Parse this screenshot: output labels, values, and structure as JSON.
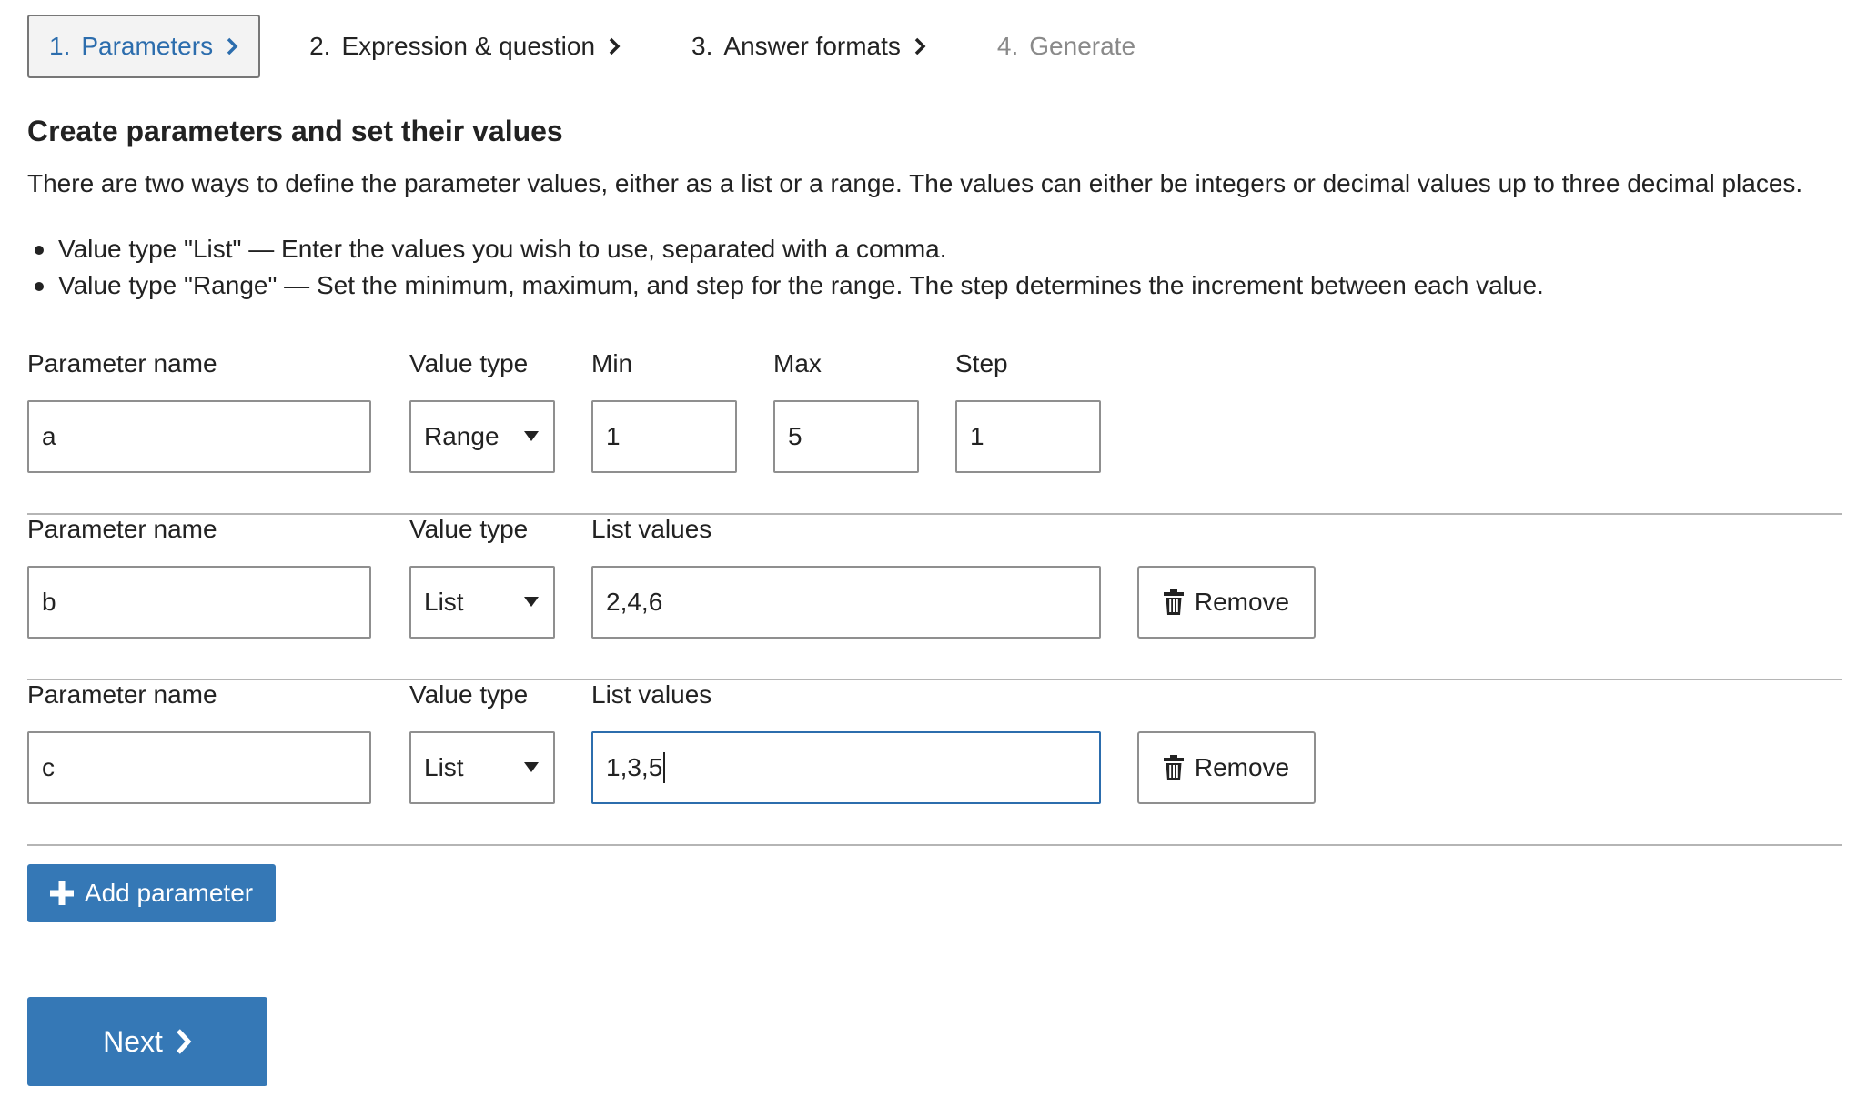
{
  "steps": [
    {
      "num": "1.",
      "label": "Parameters"
    },
    {
      "num": "2.",
      "label": "Expression & question"
    },
    {
      "num": "3.",
      "label": "Answer formats"
    },
    {
      "num": "4.",
      "label": "Generate"
    }
  ],
  "heading": "Create parameters and set their values",
  "intro": "There are two ways to define the parameter values, either as a list or a range. The values can either be integers or decimal values up to three decimal places.",
  "bullets": [
    "Value type \"List\" — Enter the values you wish to use, separated with a comma.",
    "Value type \"Range\" — Set the minimum, maximum, and step for the range. The step determines the increment between each value."
  ],
  "labels": {
    "parameter_name": "Parameter name",
    "value_type": "Value type",
    "min": "Min",
    "max": "Max",
    "step": "Step",
    "list_values": "List values"
  },
  "parameters": [
    {
      "name": "a",
      "value_type": "Range",
      "min": "1",
      "max": "5",
      "step": "1"
    },
    {
      "name": "b",
      "value_type": "List",
      "list_values": "2,4,6"
    },
    {
      "name": "c",
      "value_type": "List",
      "list_values": "1,3,5"
    }
  ],
  "buttons": {
    "remove": "Remove",
    "add_parameter": "Add parameter",
    "next": "Next"
  },
  "colors": {
    "accent": "#3578b6",
    "active_step_text": "#2c6dad",
    "disabled_step_text": "#8a8a8a"
  }
}
